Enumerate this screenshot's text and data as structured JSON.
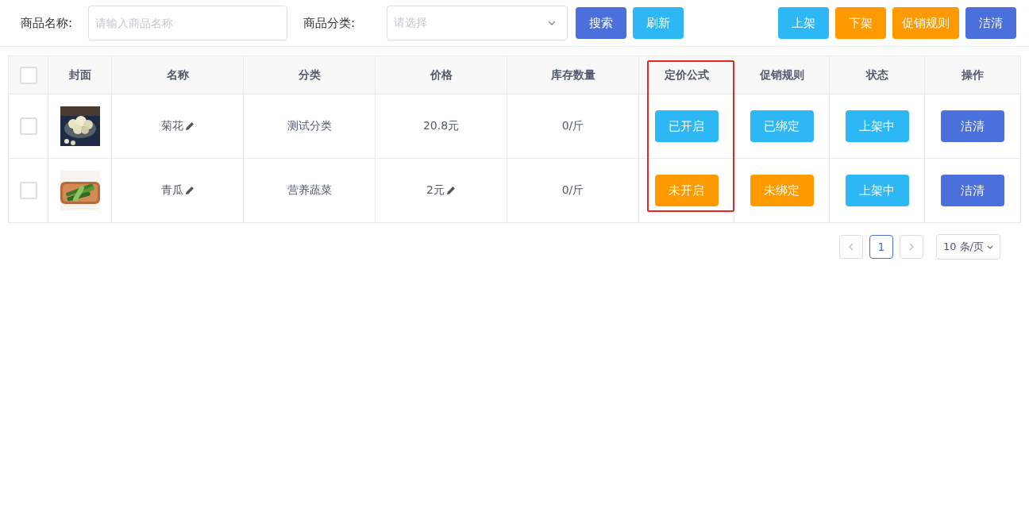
{
  "filters": [
    {
      "label": "商品名称:",
      "kind": "text",
      "placeholder": "请输入商品名称"
    },
    {
      "label": "商品分类:",
      "kind": "select",
      "placeholder": "请选择"
    }
  ],
  "filter_buttons": [
    {
      "label": "搜索",
      "kind": "primary"
    },
    {
      "label": "刷新",
      "kind": "info"
    }
  ],
  "action_buttons": [
    {
      "label": "上架",
      "kind": "info"
    },
    {
      "label": "下架",
      "kind": "warning"
    },
    {
      "label": "促销规则",
      "kind": "warning"
    },
    {
      "label": "洁清",
      "kind": "primary"
    }
  ],
  "table": {
    "select_all": {
      "checked": false
    },
    "columns": [
      {
        "label": "封面",
        "highlighted": false
      },
      {
        "label": "名称",
        "highlighted": false
      },
      {
        "label": "分类",
        "highlighted": false
      },
      {
        "label": "价格",
        "highlighted": false
      },
      {
        "label": "库存数量",
        "highlighted": false
      },
      {
        "label": "定价公式",
        "highlighted": true
      },
      {
        "label": "促销规则",
        "highlighted": false
      },
      {
        "label": "状态",
        "highlighted": false
      },
      {
        "label": "操作",
        "highlighted": false
      }
    ],
    "rows": [
      {
        "checked": false,
        "name": "菊花",
        "name_editable": true,
        "category": "测试分类",
        "price": "20.8元",
        "price_editable": false,
        "stock": "0/斤",
        "formula": {
          "label": "已开启",
          "on": true
        },
        "promotion": {
          "label": "已绑定",
          "on": true
        },
        "status": {
          "label": "上架中",
          "on": true
        },
        "operation": "洁清"
      },
      {
        "checked": false,
        "name": "青瓜",
        "name_editable": true,
        "category": "营养蔬菜",
        "price": "2元",
        "price_editable": true,
        "stock": "0/斤",
        "formula": {
          "label": "未开启",
          "on": false
        },
        "promotion": {
          "label": "未绑定",
          "on": false
        },
        "status": {
          "label": "上架中",
          "on": true
        },
        "operation": "洁清"
      }
    ]
  },
  "pagination": {
    "pages": [
      {
        "label": "1",
        "selected": true
      }
    ],
    "page_size": "10 条/页"
  }
}
